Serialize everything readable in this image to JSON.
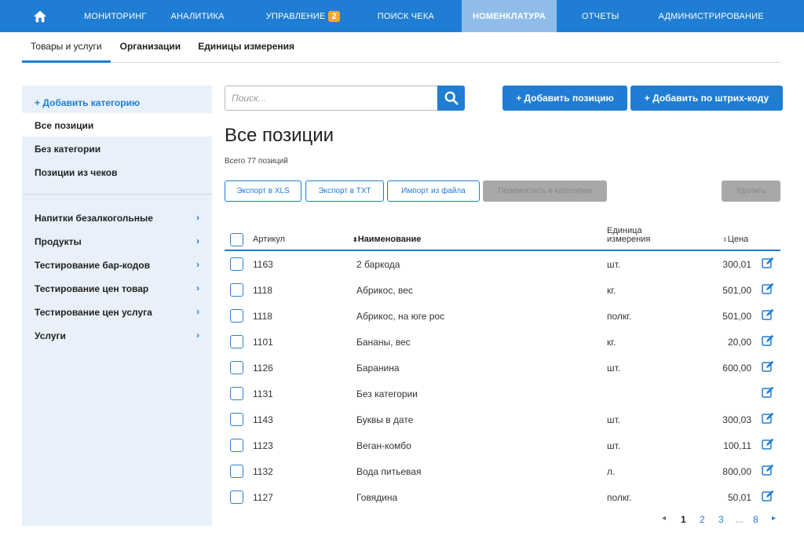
{
  "nav": {
    "items": [
      "МОНИТОРИНГ",
      "АНАЛИТИКА",
      "УПРАВЛЕНИЕ",
      "ПОИСК ЧЕКА",
      "НОМЕНКЛАТУРА",
      "ОТЧЕТЫ",
      "АДМИНИСТРИРОВАНИЕ"
    ],
    "badge": "2",
    "active": "НОМЕНКЛАТУРА"
  },
  "subtabs": [
    "Товары и услуги",
    "Организации",
    "Единицы измерения"
  ],
  "sidebar": {
    "add": "+ Добавить категорию",
    "items": [
      "Все позиции",
      "Без категории",
      "Позиции из чеков"
    ],
    "categories": [
      "Напитки безалкогольные",
      "Продукты",
      "Тестирование бар-кодов",
      "Тестирование цен товар",
      "Тестирование цен услуга",
      "Услуги"
    ],
    "chevron": "›"
  },
  "search": {
    "placeholder": "Поиск..."
  },
  "actions": {
    "add_position": "+ Добавить позицию",
    "add_barcode": "+ Добавить по штрих-коду"
  },
  "main": {
    "title": "Все позиции",
    "count": "Всего 77 позиций"
  },
  "toolbar": {
    "export_xls": "Экспорт в XLS",
    "export_txt": "Экспорт в TXT",
    "import": "Импорт из файла",
    "move": "Переместить в категорию",
    "delete": "Удалить"
  },
  "table": {
    "headers": {
      "article": "Артикул",
      "name": "Наименование",
      "unit": "Единица измерения",
      "price": "Цена"
    },
    "rows": [
      {
        "article": "1163",
        "name": "2 баркода",
        "unit": "шт.",
        "price": "300,01"
      },
      {
        "article": "1118",
        "name": "Абрикос, вес",
        "unit": "кг.",
        "price": "501,00"
      },
      {
        "article": "1118",
        "name": "Абрикос, на юге рос",
        "unit": "полкг.",
        "price": "501,00"
      },
      {
        "article": "1101",
        "name": "Бананы, вес",
        "unit": "кг.",
        "price": "20,00"
      },
      {
        "article": "1126",
        "name": "Баранина",
        "unit": "шт.",
        "price": "600,00"
      },
      {
        "article": "1131",
        "name": "Без категории",
        "unit": "",
        "price": ""
      },
      {
        "article": "1143",
        "name": "Буквы в дате",
        "unit": "шт.",
        "price": "300,03"
      },
      {
        "article": "1123",
        "name": "Веган-комбо",
        "unit": "шт.",
        "price": "100,11"
      },
      {
        "article": "1132",
        "name": "Вода питьевая",
        "unit": "л.",
        "price": "800,00"
      },
      {
        "article": "1127",
        "name": "Говядина",
        "unit": "полкг.",
        "price": "50,01"
      }
    ]
  },
  "pagination": {
    "prev": "◂",
    "pages": [
      "1",
      "2",
      "3"
    ],
    "ellipsis": "...",
    "last": "8",
    "next": "▸",
    "current": "1"
  },
  "colors": {
    "accent": "#1f7dd3",
    "nav_active": "#8fbde8",
    "badge": "#f0a830",
    "sidebar_bg": "#e8f1fa"
  }
}
